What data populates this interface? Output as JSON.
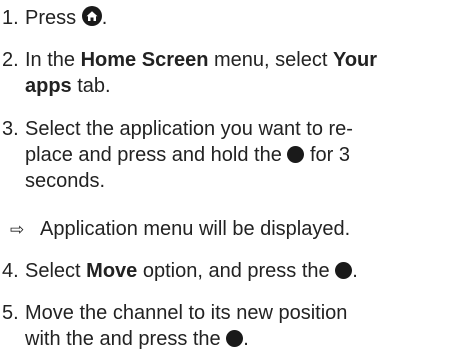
{
  "steps": [
    {
      "number": "1.",
      "text_1": "Press",
      "icon": "home-icon",
      "text_2": "."
    },
    {
      "number": "2.",
      "line1_pre": "In the ",
      "line1_bold1": "Home Screen",
      "line1_mid": " menu, select ",
      "line1_bold2": "Your",
      "line2_bold": "apps",
      "line2_post": " tab."
    },
    {
      "number": "3.",
      "line1": "Select the application you want to re-",
      "line2_pre": "place and press and hold the ",
      "line2_post": " for 3",
      "line3": "seconds.",
      "icon": "ok-button-dot"
    },
    {
      "arrow": "⇨",
      "result": "Application menu will be displayed."
    },
    {
      "number": "4.",
      "pre": "Select ",
      "bold": "Move",
      "mid": " option, and press the ",
      "post": ".",
      "icon": "ok-button-dot"
    },
    {
      "number": "5.",
      "line1": "Move the channel to its new position",
      "line2_pre": "with the and press the ",
      "line2_post": ".",
      "icon": "ok-button-dot"
    }
  ]
}
